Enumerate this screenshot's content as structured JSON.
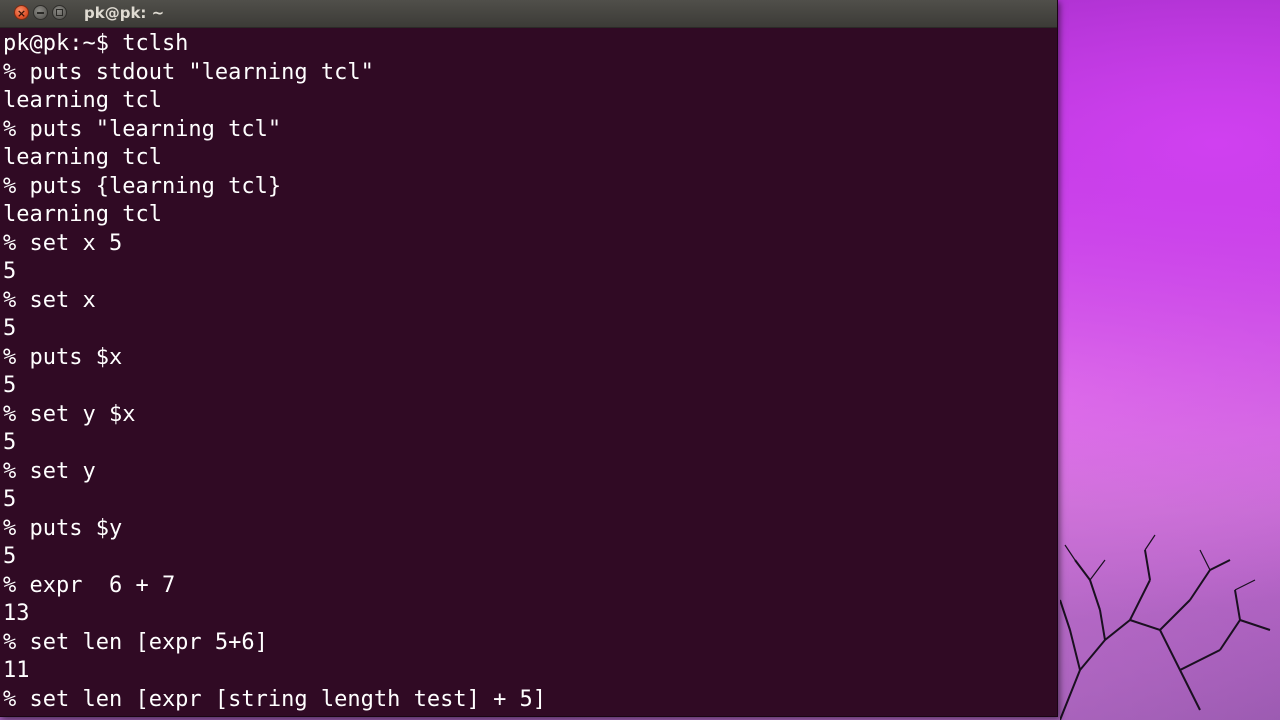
{
  "window": {
    "title": "pk@pk: ~",
    "close_glyph": "×",
    "icons": [
      "close-icon",
      "minimize-icon",
      "maximize-icon"
    ]
  },
  "colors": {
    "terminal_bg": "#300a24",
    "terminal_fg": "#ffffff",
    "titlebar": "#3c3b37",
    "close_button": "#e0532a"
  },
  "terminal": {
    "lines": [
      "pk@pk:~$ tclsh",
      "% puts stdout \"learning tcl\"",
      "learning tcl",
      "% puts \"learning tcl\"",
      "learning tcl",
      "% puts {learning tcl}",
      "learning tcl",
      "% set x 5",
      "5",
      "% set x",
      "5",
      "% puts $x",
      "5",
      "% set y $x",
      "5",
      "% set y",
      "5",
      "% puts $y",
      "5",
      "% expr  6 + 7",
      "13",
      "% set len [expr 5+6]",
      "11",
      "% set len [expr [string length test] + 5]"
    ]
  }
}
